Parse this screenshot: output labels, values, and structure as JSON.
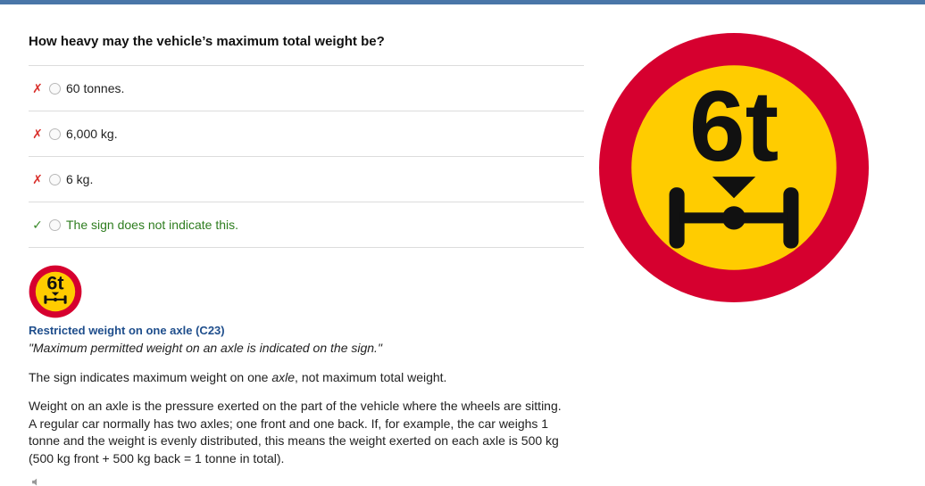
{
  "question": {
    "text": "How heavy may the vehicle’s maximum total weight be?"
  },
  "answers": [
    {
      "mark": "✗",
      "text": "60 tonnes.",
      "correct": false
    },
    {
      "mark": "✗",
      "text": "6,000 kg.",
      "correct": false
    },
    {
      "mark": "✗",
      "text": "6 kg.",
      "correct": false
    },
    {
      "mark": "✓",
      "text": "The sign does not indicate this.",
      "correct": true
    }
  ],
  "sign": {
    "label": "6t",
    "title": "Restricted weight on one axle (C23)",
    "quote": "\"Maximum permitted weight on an axle is indicated on the sign.\"",
    "colors": {
      "ring": "#d6002f",
      "fill": "#ffcc00",
      "ink": "#111111"
    }
  },
  "explanation": {
    "para1_before": "The sign indicates maximum weight on one ",
    "para1_em": "axle",
    "para1_after": ", not maximum total weight.",
    "para2": "Weight on an axle is the pressure exerted on the part of the vehicle where the wheels are sitting. A regular car normally has two axles; one front and one back. If, for example, the car weighs 1 tonne and the weight is evenly distributed, this means the weight exerted on each axle is 500 kg (500 kg front + 500 kg back = 1 tonne in total)."
  },
  "icons": {
    "wrong": "x-mark-icon",
    "right": "check-mark-icon",
    "audio": "speaker-icon"
  }
}
